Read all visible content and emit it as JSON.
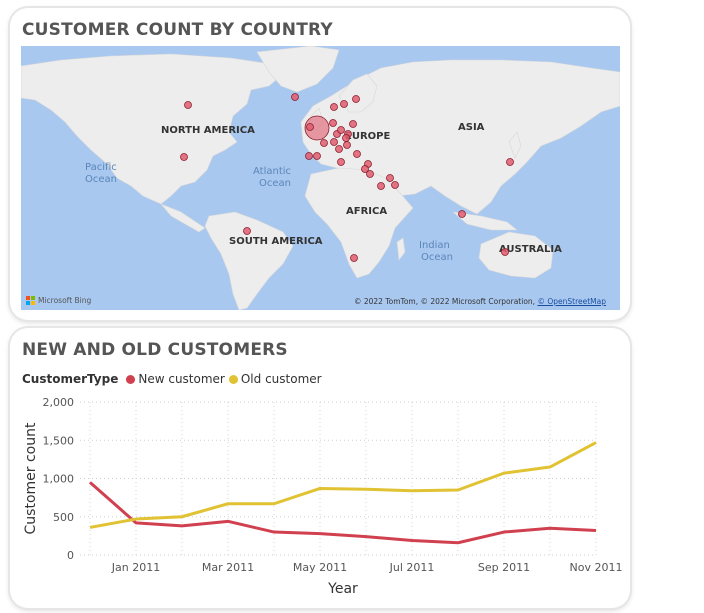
{
  "map_card": {
    "title": "CUSTOMER COUNT BY COUNTRY",
    "continents": {
      "north_america": "NORTH AMERICA",
      "europe": "EUROPE",
      "asia": "ASIA",
      "africa": "AFRICA",
      "south_america": "SOUTH AMERICA",
      "australia": "AUSTRALIA"
    },
    "oceans": {
      "pacific_1": "Pacific",
      "pacific_2": "Ocean",
      "atlantic_1": "Atlantic",
      "atlantic_2": "Ocean",
      "indian_1": "Indian",
      "indian_2": "Ocean"
    },
    "bing_label": "Microsoft Bing",
    "attribution": "© 2022 TomTom, © 2022 Microsoft Corporation,",
    "attribution_link": "© OpenStreetMap",
    "bubble_color": "#e05c6e",
    "ocean_color": "#a9c8f0",
    "land_color": "#ededed"
  },
  "chart_card": {
    "title": "NEW AND OLD CUSTOMERS",
    "legend_title": "CustomerType",
    "icon": "legend-dot"
  },
  "chart_data": {
    "type": "line",
    "title": "NEW AND OLD CUSTOMERS",
    "xlabel": "Year",
    "ylabel": "Customer count",
    "ylim": [
      0,
      2000
    ],
    "yticks": [
      "0",
      "500",
      "1,000",
      "1,500",
      "2,000"
    ],
    "ytick_values": [
      0,
      500,
      1000,
      1500,
      2000
    ],
    "x": [
      "Dec 2010",
      "Jan 2011",
      "Feb 2011",
      "Mar 2011",
      "Apr 2011",
      "May 2011",
      "Jun 2011",
      "Jul 2011",
      "Aug 2011",
      "Sep 2011",
      "Oct 2011",
      "Nov 2011"
    ],
    "xtick_labels": [
      "Jan 2011",
      "Mar 2011",
      "May 2011",
      "Jul 2011",
      "Sep 2011",
      "Nov 2011"
    ],
    "xtick_indices": [
      1,
      3,
      5,
      7,
      9,
      11
    ],
    "grid": true,
    "legend_position": "top-left",
    "series": [
      {
        "name": "New customer",
        "color": "#d0404f",
        "values": [
          950,
          420,
          380,
          440,
          300,
          280,
          240,
          190,
          160,
          300,
          350,
          320
        ]
      },
      {
        "name": "Old customer",
        "color": "#e0c232",
        "values": [
          360,
          470,
          500,
          670,
          670,
          870,
          860,
          840,
          850,
          1070,
          1150,
          1470
        ]
      }
    ]
  }
}
